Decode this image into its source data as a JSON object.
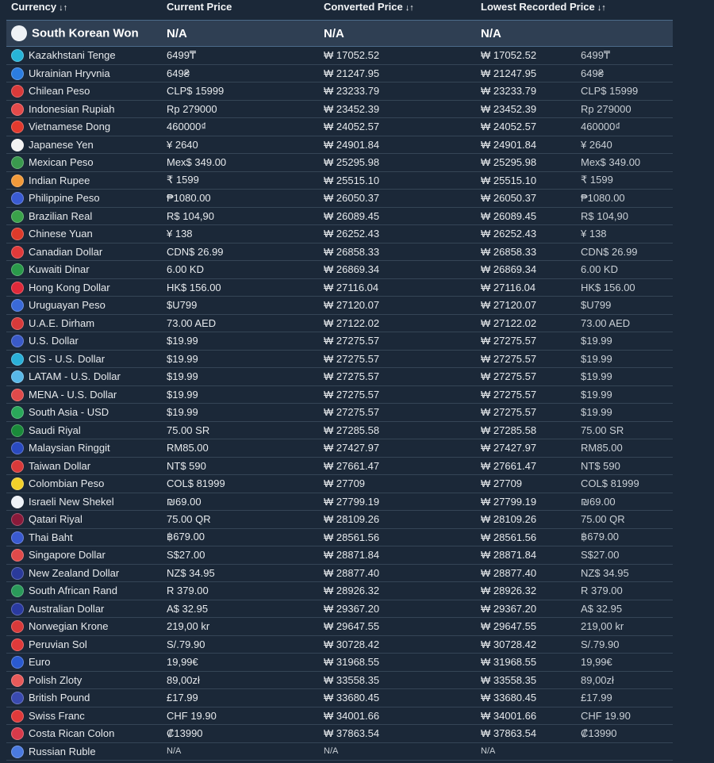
{
  "headers": {
    "currency": "Currency",
    "current": "Current Price",
    "converted": "Converted Price",
    "lowest": "Lowest Recorded Price",
    "sort_glyph": "↓↑"
  },
  "base": {
    "name": "South Korean Won",
    "current": "N/A",
    "converted": "N/A",
    "lowest": "N/A",
    "flag": "#eef2f6"
  },
  "rows": [
    {
      "name": "Kazakhstani Tenge",
      "current": "6499₸",
      "converted": "₩ 17052.52",
      "lowest": "₩ 17052.52",
      "lowest_local": "6499₸",
      "flag": "#27b4d8"
    },
    {
      "name": "Ukrainian Hryvnia",
      "current": "649₴",
      "converted": "₩ 21247.95",
      "lowest": "₩ 21247.95",
      "lowest_local": "649₴",
      "flag": "#2b7de1"
    },
    {
      "name": "Chilean Peso",
      "current": "CLP$ 15999",
      "converted": "₩ 23233.79",
      "lowest": "₩ 23233.79",
      "lowest_local": "CLP$ 15999",
      "flag": "#d93a3a"
    },
    {
      "name": "Indonesian Rupiah",
      "current": "Rp 279000",
      "converted": "₩ 23452.39",
      "lowest": "₩ 23452.39",
      "lowest_local": "Rp 279000",
      "flag": "#e44a4a"
    },
    {
      "name": "Vietnamese Dong",
      "current": "460000₫",
      "converted": "₩ 24052.57",
      "lowest": "₩ 24052.57",
      "lowest_local": "460000₫",
      "flag": "#e23a2e"
    },
    {
      "name": "Japanese Yen",
      "current": "¥ 2640",
      "converted": "₩ 24901.84",
      "lowest": "₩ 24901.84",
      "lowest_local": "¥ 2640",
      "flag": "#f3f3f3"
    },
    {
      "name": "Mexican Peso",
      "current": "Mex$ 349.00",
      "converted": "₩ 25295.98",
      "lowest": "₩ 25295.98",
      "lowest_local": "Mex$ 349.00",
      "flag": "#3a9a4e"
    },
    {
      "name": "Indian Rupee",
      "current": "₹ 1599",
      "converted": "₩ 25515.10",
      "lowest": "₩ 25515.10",
      "lowest_local": "₹ 1599",
      "flag": "#f29a3a"
    },
    {
      "name": "Philippine Peso",
      "current": "₱1080.00",
      "converted": "₩ 26050.37",
      "lowest": "₩ 26050.37",
      "lowest_local": "₱1080.00",
      "flag": "#3a5bd3"
    },
    {
      "name": "Brazilian Real",
      "current": "R$ 104,90",
      "converted": "₩ 26089.45",
      "lowest": "₩ 26089.45",
      "lowest_local": "R$ 104,90",
      "flag": "#3aa24a"
    },
    {
      "name": "Chinese Yuan",
      "current": "¥ 138",
      "converted": "₩ 26252.43",
      "lowest": "₩ 26252.43",
      "lowest_local": "¥ 138",
      "flag": "#de3a2a"
    },
    {
      "name": "Canadian Dollar",
      "current": "CDN$ 26.99",
      "converted": "₩ 26858.33",
      "lowest": "₩ 26858.33",
      "lowest_local": "CDN$ 26.99",
      "flag": "#e03a3a"
    },
    {
      "name": "Kuwaiti Dinar",
      "current": "6.00 KD",
      "converted": "₩ 26869.34",
      "lowest": "₩ 26869.34",
      "lowest_local": "6.00 KD",
      "flag": "#2a9a4a"
    },
    {
      "name": "Hong Kong Dollar",
      "current": "HK$ 156.00",
      "converted": "₩ 27116.04",
      "lowest": "₩ 27116.04",
      "lowest_local": "HK$ 156.00",
      "flag": "#e02a3a"
    },
    {
      "name": "Uruguayan Peso",
      "current": "$U799",
      "converted": "₩ 27120.07",
      "lowest": "₩ 27120.07",
      "lowest_local": "$U799",
      "flag": "#3a6ad8"
    },
    {
      "name": "U.A.E. Dirham",
      "current": "73.00 AED",
      "converted": "₩ 27122.02",
      "lowest": "₩ 27122.02",
      "lowest_local": "73.00 AED",
      "flag": "#d83a3a"
    },
    {
      "name": "U.S. Dollar",
      "current": "$19.99",
      "converted": "₩ 27275.57",
      "lowest": "₩ 27275.57",
      "lowest_local": "$19.99",
      "flag": "#3a5ac8"
    },
    {
      "name": "CIS - U.S. Dollar",
      "current": "$19.99",
      "converted": "₩ 27275.57",
      "lowest": "₩ 27275.57",
      "lowest_local": "$19.99",
      "flag": "#2ab0d8"
    },
    {
      "name": "LATAM - U.S. Dollar",
      "current": "$19.99",
      "converted": "₩ 27275.57",
      "lowest": "₩ 27275.57",
      "lowest_local": "$19.99",
      "flag": "#58b8e8"
    },
    {
      "name": "MENA - U.S. Dollar",
      "current": "$19.99",
      "converted": "₩ 27275.57",
      "lowest": "₩ 27275.57",
      "lowest_local": "$19.99",
      "flag": "#e04a4a"
    },
    {
      "name": "South Asia - USD",
      "current": "$19.99",
      "converted": "₩ 27275.57",
      "lowest": "₩ 27275.57",
      "lowest_local": "$19.99",
      "flag": "#2aa85a"
    },
    {
      "name": "Saudi Riyal",
      "current": "75.00 SR",
      "converted": "₩ 27285.58",
      "lowest": "₩ 27285.58",
      "lowest_local": "75.00 SR",
      "flag": "#1a8a3a"
    },
    {
      "name": "Malaysian Ringgit",
      "current": "RM85.00",
      "converted": "₩ 27427.97",
      "lowest": "₩ 27427.97",
      "lowest_local": "RM85.00",
      "flag": "#2a4ac0"
    },
    {
      "name": "Taiwan Dollar",
      "current": "NT$ 590",
      "converted": "₩ 27661.47",
      "lowest": "₩ 27661.47",
      "lowest_local": "NT$ 590",
      "flag": "#d83a3a"
    },
    {
      "name": "Colombian Peso",
      "current": "COL$ 81999",
      "converted": "₩ 27709",
      "lowest": "₩ 27709",
      "lowest_local": "COL$ 81999",
      "flag": "#f2d02a"
    },
    {
      "name": "Israeli New Shekel",
      "current": "₪69.00",
      "converted": "₩ 27799.19",
      "lowest": "₩ 27799.19",
      "lowest_local": "₪69.00",
      "flag": "#eef2f8"
    },
    {
      "name": "Qatari Riyal",
      "current": "75.00 QR",
      "converted": "₩ 28109.26",
      "lowest": "₩ 28109.26",
      "lowest_local": "75.00 QR",
      "flag": "#8a1a3a"
    },
    {
      "name": "Thai Baht",
      "current": "฿679.00",
      "converted": "₩ 28561.56",
      "lowest": "₩ 28561.56",
      "lowest_local": "฿679.00",
      "flag": "#3a5ad0"
    },
    {
      "name": "Singapore Dollar",
      "current": "S$27.00",
      "converted": "₩ 28871.84",
      "lowest": "₩ 28871.84",
      "lowest_local": "S$27.00",
      "flag": "#e04a4a"
    },
    {
      "name": "New Zealand Dollar",
      "current": "NZ$ 34.95",
      "converted": "₩ 28877.40",
      "lowest": "₩ 28877.40",
      "lowest_local": "NZ$ 34.95",
      "flag": "#2a3a9a"
    },
    {
      "name": "South African Rand",
      "current": "R 379.00",
      "converted": "₩ 28926.32",
      "lowest": "₩ 28926.32",
      "lowest_local": "R 379.00",
      "flag": "#2a9a5a"
    },
    {
      "name": "Australian Dollar",
      "current": "A$ 32.95",
      "converted": "₩ 29367.20",
      "lowest": "₩ 29367.20",
      "lowest_local": "A$ 32.95",
      "flag": "#2a3aa0"
    },
    {
      "name": "Norwegian Krone",
      "current": "219,00 kr",
      "converted": "₩ 29647.55",
      "lowest": "₩ 29647.55",
      "lowest_local": "219,00 kr",
      "flag": "#d83a3a"
    },
    {
      "name": "Peruvian Sol",
      "current": "S/.79.90",
      "converted": "₩ 30728.42",
      "lowest": "₩ 30728.42",
      "lowest_local": "S/.79.90",
      "flag": "#e03a3a"
    },
    {
      "name": "Euro",
      "current": "19,99€",
      "converted": "₩ 31968.55",
      "lowest": "₩ 31968.55",
      "lowest_local": "19,99€",
      "flag": "#2a5ad0"
    },
    {
      "name": "Polish Zloty",
      "current": "89,00zł",
      "converted": "₩ 33558.35",
      "lowest": "₩ 33558.35",
      "lowest_local": "89,00zł",
      "flag": "#e85a5a"
    },
    {
      "name": "British Pound",
      "current": "£17.99",
      "converted": "₩ 33680.45",
      "lowest": "₩ 33680.45",
      "lowest_local": "£17.99",
      "flag": "#3a4ab0"
    },
    {
      "name": "Swiss Franc",
      "current": "CHF 19.90",
      "converted": "₩ 34001.66",
      "lowest": "₩ 34001.66",
      "lowest_local": "CHF 19.90",
      "flag": "#e03a3a"
    },
    {
      "name": "Costa Rican Colon",
      "current": "₡13990",
      "converted": "₩ 37863.54",
      "lowest": "₩ 37863.54",
      "lowest_local": "₡13990",
      "flag": "#d83a4a"
    },
    {
      "name": "Russian Ruble",
      "current": "N/A",
      "converted": "N/A",
      "lowest": "N/A",
      "lowest_local": "",
      "flag": "#4a7ae0",
      "na": true
    }
  ]
}
